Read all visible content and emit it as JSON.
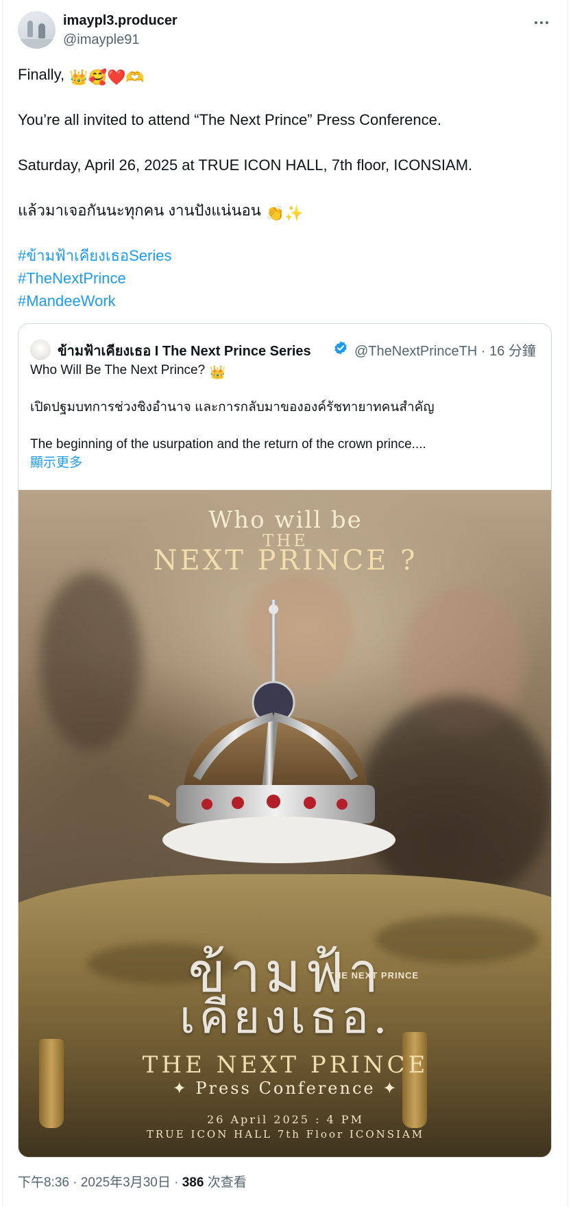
{
  "author": {
    "display_name": "imaypl3.producer",
    "handle": "@imayple91"
  },
  "tweet": {
    "line1": "Finally,",
    "line1_emojis": "👑🥰❤️🫶",
    "line2": "You’re all invited to attend “The Next Prince” Press Conference.",
    "line3": "Saturday, April 26, 2025 at TRUE ICON HALL, 7th floor, ICONSIAM.",
    "line4": "แล้วมาเจอกันนะทุกคน งานปังแน่นอน",
    "line4_emojis": "👏✨",
    "hashtags": [
      "#ข้ามฟ้าเคียงเธอSeries",
      "#TheNextPrince",
      "#MandeeWork"
    ]
  },
  "quote": {
    "name": "ข้ามฟ้าเคียงเธอ I The Next Prince Series",
    "handle_time": "@TheNextPrinceTH · 16 分鐘",
    "line1": "Who Will Be The Next Prince?",
    "line1_emoji": "👑",
    "line2": "เปิดปฐมบทการช่วงชิงอำนาจ และการกลับมาขององค์รัชทายาทคนสำคัญ",
    "line3": "The beginning of the usurpation and the return of the crown prince....",
    "show_more": "顯示更多",
    "verified_color": "#1d9bf0"
  },
  "poster": {
    "headline_1": "Who will be",
    "headline_2": "THE",
    "headline_3": "NEXT PRINCE ?",
    "logo_thai_1": "ข้ามฟ้า",
    "logo_thai_2": "เคียงเธอ.",
    "logo_small": "THE NEXT PRINCE",
    "title": "THE NEXT PRINCE",
    "subtitle": "✦ Press Conference ✦",
    "date_line": "26 April 2025 : 4 PM",
    "venue_line": "TRUE ICON HALL 7th Floor ICONSIAM"
  },
  "meta": {
    "timestamp": "下午8:36 · 2025年3月30日 · ",
    "views_count": "386",
    "views_label": " 次查看"
  },
  "colors": {
    "link": "#1d9bf0",
    "secondary_text": "#536471",
    "primary_text": "#0f1419",
    "border": "#cfd9de"
  }
}
